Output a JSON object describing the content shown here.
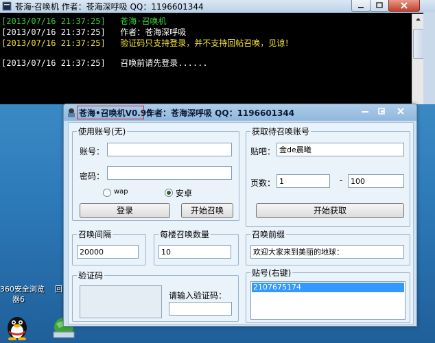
{
  "console": {
    "title": "苍海·召唤机  作者：苍海深呼吸  QQ：1196601344",
    "lines": [
      {
        "ts": "[2013/07/16 21:37:25]",
        "text": "苍海·召唤机",
        "color": "#39d03a"
      },
      {
        "ts": "[2013/07/16 21:37:25]",
        "text": "作者：苍海深呼吸",
        "color": "#ffffff"
      },
      {
        "ts": "[2013/07/16 21:37:25]",
        "text": "验证码只支持登录，并不支持回帖召唤，见谅！",
        "color": "#f2e33a"
      },
      {
        "ts": "[2013/07/16 21:37:25]",
        "text": "召唤前请先登录......",
        "color": "#ffffff"
      }
    ]
  },
  "app": {
    "title_highlight": "苍海•召唤机V0.95",
    "title_rest": "作者：苍海深呼吸  QQ：1196601344",
    "account_group": {
      "title": "使用账号(无)",
      "username_label": "账号：",
      "username_value": "",
      "password_label": "密码：",
      "password_value": "",
      "radio_wap": "wap",
      "radio_android": "安卓",
      "selected_radio": "安卓",
      "login_button": "登录",
      "start_summon_button": "开始召唤"
    },
    "target_group": {
      "title": "获取待召唤账号",
      "tieba_label": "贴吧：",
      "tieba_value": "金de晨曦",
      "pages_label": "页数：",
      "page_from": "1",
      "page_sep": "-",
      "page_to": "100",
      "fetch_button": "开始获取"
    },
    "interval_group": {
      "title": "召唤间隔",
      "value": "20000"
    },
    "per_floor_group": {
      "title": "每楼召唤数量",
      "value": "10"
    },
    "prefix_group": {
      "title": "召唤前缀",
      "value": "欢迎大家来到美丽的地球："
    },
    "captcha_group": {
      "title": "验证码",
      "prompt": "请输入验证码：",
      "value": ""
    },
    "accounts_group": {
      "title": "贴号(右键)",
      "items": [
        "2107675174"
      ]
    }
  },
  "desktop": {
    "icon_label_1": "360安全浏览",
    "icon_label_2": "器6",
    "icon_label_3": "回"
  }
}
